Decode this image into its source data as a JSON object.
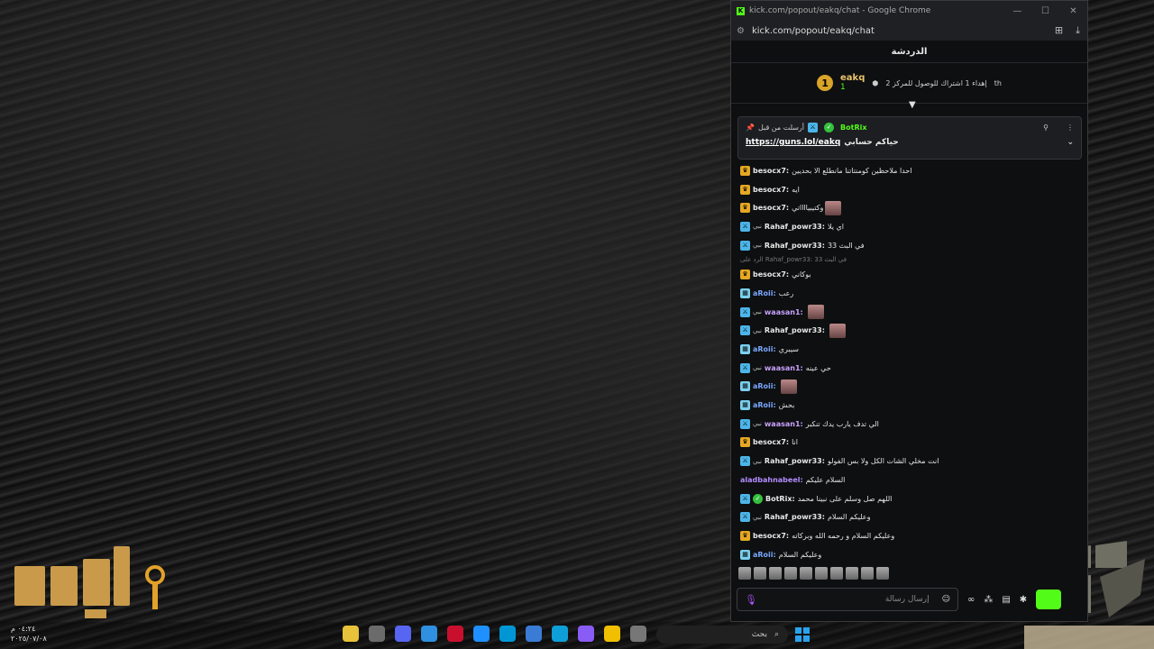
{
  "window": {
    "title": "kick.com/popout/eakq/chat - Google Chrome",
    "url": "kick.com/popout/eakq/chat",
    "controls": [
      "—",
      "☐",
      "✕"
    ]
  },
  "chat": {
    "header": "الدردشة",
    "goal": "إهداء 1 اشتراك للوصول للمركز 2",
    "goal_suffix": "th",
    "top_gifter": {
      "rank": "1",
      "name": "eakq",
      "count": "1"
    },
    "pinned": {
      "label": "أرسلت من قبل",
      "author": "BotRix",
      "text": "حياكم حسابي",
      "link": "https://guns.lol/eakq"
    },
    "messages": [
      {
        "user": "besocx7:",
        "color": "#e8e8e8",
        "badge": "crown",
        "text": "احدا ملاحظين كومنتاتنا مانطلع الا بحديين"
      },
      {
        "user": "besocx7:",
        "color": "#e8e8e8",
        "badge": "crown",
        "text": "ايه"
      },
      {
        "user": "besocx7:",
        "color": "#e8e8e8",
        "badge": "crown",
        "text": "وكتيبيااااتي",
        "emote": true
      },
      {
        "user": "Rahaf_powr33:",
        "color": "#e8e8e8",
        "badge": "sub",
        "badge2": "نبي",
        "text": "اي يلا"
      },
      {
        "user": "Rahaf_powr33:",
        "color": "#e8e8e8",
        "badge": "sub",
        "badge2": "نبي",
        "text": "في البث 33"
      },
      {
        "reply": "الرد على Rahaf_powr33: 33 في البث"
      },
      {
        "user": "besocx7:",
        "color": "#e8e8e8",
        "badge": "crown",
        "text": "بوكاني"
      },
      {
        "user": "aRoii:",
        "color": "#7aa7ff",
        "badge": "square",
        "text": "رعب"
      },
      {
        "user": "waasan1:",
        "color": "#c9a2ff",
        "badge": "sub",
        "badge2": "نبي",
        "text": "",
        "emote": true
      },
      {
        "user": "Rahaf_powr33:",
        "color": "#e8e8e8",
        "badge": "sub",
        "badge2": "نبي",
        "text": "",
        "emote": true
      },
      {
        "user": "aRoii:",
        "color": "#7aa7ff",
        "badge": "square",
        "text": "سيبري"
      },
      {
        "user": "waasan1:",
        "color": "#c9a2ff",
        "badge": "sub",
        "badge2": "نبي",
        "text": "حي عينه"
      },
      {
        "user": "aRoii:",
        "color": "#7aa7ff",
        "badge": "square",
        "text": "",
        "emote": true
      },
      {
        "user": "aRoii:",
        "color": "#7aa7ff",
        "badge": "square",
        "text": "بحش"
      },
      {
        "user": "waasan1:",
        "color": "#c9a2ff",
        "badge": "sub",
        "badge2": "نبي",
        "text": "الي تدف يارب يدك تنكبر"
      },
      {
        "user": "besocx7:",
        "color": "#e8e8e8",
        "badge": "crown",
        "text": "انا"
      },
      {
        "user": "Rahaf_powr33:",
        "color": "#e8e8e8",
        "badge": "sub",
        "badge2": "نبي",
        "text": "انت مخلي الشات الكل ولا بس الفولو"
      },
      {
        "user": "aladbahnabeel:",
        "color": "#b28cff",
        "badge": "",
        "text": "السلام عليكم"
      },
      {
        "user": "BotRix:",
        "color": "#e8e8e8",
        "badge": "sub",
        "badge3": "bot",
        "text": "اللهم صل وسلم على نبينا محمد"
      },
      {
        "user": "Rahaf_powr33:",
        "color": "#e8e8e8",
        "badge": "sub",
        "badge2": "نبي",
        "text": "وعليكم السلام"
      },
      {
        "user": "besocx7:",
        "color": "#e8e8e8",
        "badge": "crown",
        "text": "وعليكم السلام و رحمه الله وبركاته"
      },
      {
        "user": "aRoii:",
        "color": "#7aa7ff",
        "badge": "square",
        "text": "وعليكم السلام"
      }
    ],
    "input_placeholder": "إرسال رسالة"
  },
  "taskbar": {
    "search_placeholder": "بحث",
    "time": "٠٤:٢٤ م",
    "date": "٢٠٢٥/٠٧/٠٨"
  }
}
